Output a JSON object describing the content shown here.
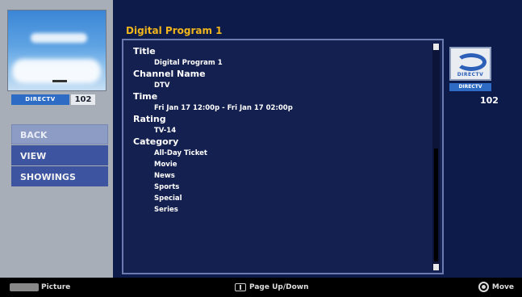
{
  "preview": {
    "tag": "DIRECTV",
    "channel": "102"
  },
  "menu": {
    "items": [
      {
        "label": "BACK"
      },
      {
        "label": "VIEW"
      },
      {
        "label": "SHOWINGS"
      }
    ]
  },
  "program": {
    "title": "Digital Program 1",
    "fields": [
      {
        "label": "Title",
        "values": [
          "Digital Program 1"
        ]
      },
      {
        "label": "Channel Name",
        "values": [
          "DTV"
        ]
      },
      {
        "label": "Time",
        "values": [
          "Fri Jan 17 12:00p - Fri Jan 17 02:00p"
        ]
      },
      {
        "label": "Rating",
        "values": [
          "TV-14"
        ]
      },
      {
        "label": "Category",
        "values": [
          "All-Day Ticket",
          "Movie",
          "News",
          "Sports",
          "Special",
          "Series"
        ]
      }
    ]
  },
  "logo": {
    "brand": "DIRECTV",
    "tag": "DIRECTV",
    "channel": "102"
  },
  "footer": {
    "left_label": "Picture",
    "middle_label": "Page Up/Down",
    "right_label": "Move"
  },
  "colors": {
    "background": "#0d1b4b",
    "accent_title": "#f0b51c",
    "panel": "#a8aeb8"
  }
}
